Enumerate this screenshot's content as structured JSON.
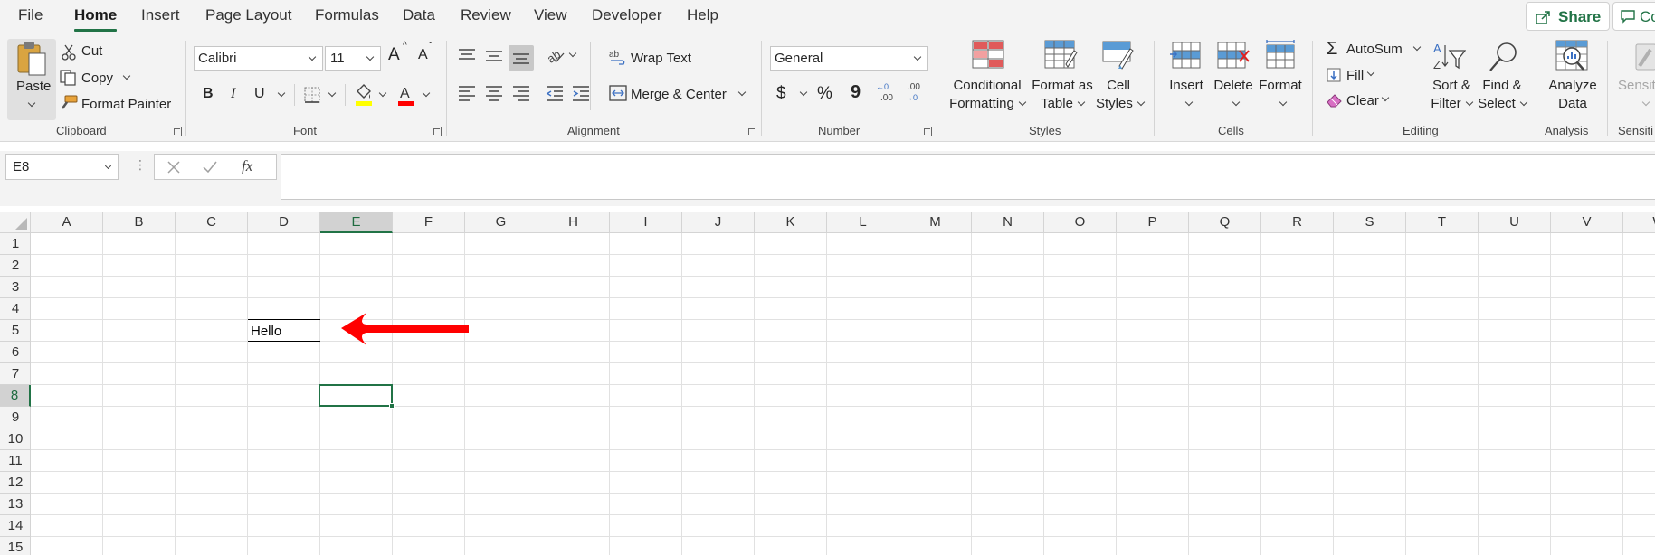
{
  "tabs": [
    {
      "label": "File"
    },
    {
      "label": "Home"
    },
    {
      "label": "Insert"
    },
    {
      "label": "Page Layout"
    },
    {
      "label": "Formulas"
    },
    {
      "label": "Data"
    },
    {
      "label": "Review"
    },
    {
      "label": "View"
    },
    {
      "label": "Developer"
    },
    {
      "label": "Help"
    }
  ],
  "active_tab": "Home",
  "share": {
    "label": "Share"
  },
  "comments": {
    "label": "Co"
  },
  "clipboard": {
    "paste": "Paste",
    "cut": "Cut",
    "copy": "Copy",
    "format_painter": "Format Painter",
    "label": "Clipboard"
  },
  "font": {
    "name": "Calibri",
    "size": "11",
    "bold": "B",
    "italic": "I",
    "underline": "U",
    "grow": "A",
    "shrink": "A",
    "label": "Font"
  },
  "alignment": {
    "wrap_text": "Wrap Text",
    "merge_center": "Merge & Center",
    "label": "Alignment"
  },
  "number": {
    "format": "General",
    "currency": "$",
    "percent": "%",
    "comma": "9",
    "inc_decimal": ".00",
    "dec_decimal": ".00",
    "label": "Number"
  },
  "styles": {
    "conditional_formatting": [
      "Conditional",
      "Formatting"
    ],
    "format_as_table": [
      "Format as",
      "Table"
    ],
    "cell_styles": [
      "Cell",
      "Styles"
    ],
    "label": "Styles"
  },
  "cells": {
    "insert": "Insert",
    "delete": "Delete",
    "format": "Format",
    "label": "Cells"
  },
  "editing": {
    "autosum": "AutoSum",
    "fill": "Fill",
    "clear": "Clear",
    "sort_filter": [
      "Sort &",
      "Filter"
    ],
    "find_select": [
      "Find &",
      "Select"
    ],
    "label": "Editing"
  },
  "analysis": {
    "analyze_data": [
      "Analyze",
      "Data"
    ],
    "label": "Analysis"
  },
  "sensitivity": {
    "button": "Sensiti",
    "label": "Sensiti"
  },
  "formula_bar": {
    "name_box": "E8",
    "fx": "fx",
    "formula": ""
  },
  "columns": [
    "A",
    "B",
    "C",
    "D",
    "E",
    "F",
    "G",
    "H",
    "I",
    "J",
    "K",
    "L",
    "M",
    "N",
    "O",
    "P",
    "Q",
    "R",
    "S",
    "T",
    "U",
    "V",
    "W"
  ],
  "rows": [
    "1",
    "2",
    "3",
    "4",
    "5",
    "6",
    "7",
    "8",
    "9",
    "10",
    "11",
    "12",
    "13",
    "14",
    "15"
  ],
  "selected_cell": "E8",
  "cells_content": [
    {
      "ref": "D5",
      "value": "Hello"
    }
  ],
  "colors": {
    "accent": "#217346",
    "arrow": "#ff0000",
    "ribbon_bg": "#f3f3f3"
  }
}
